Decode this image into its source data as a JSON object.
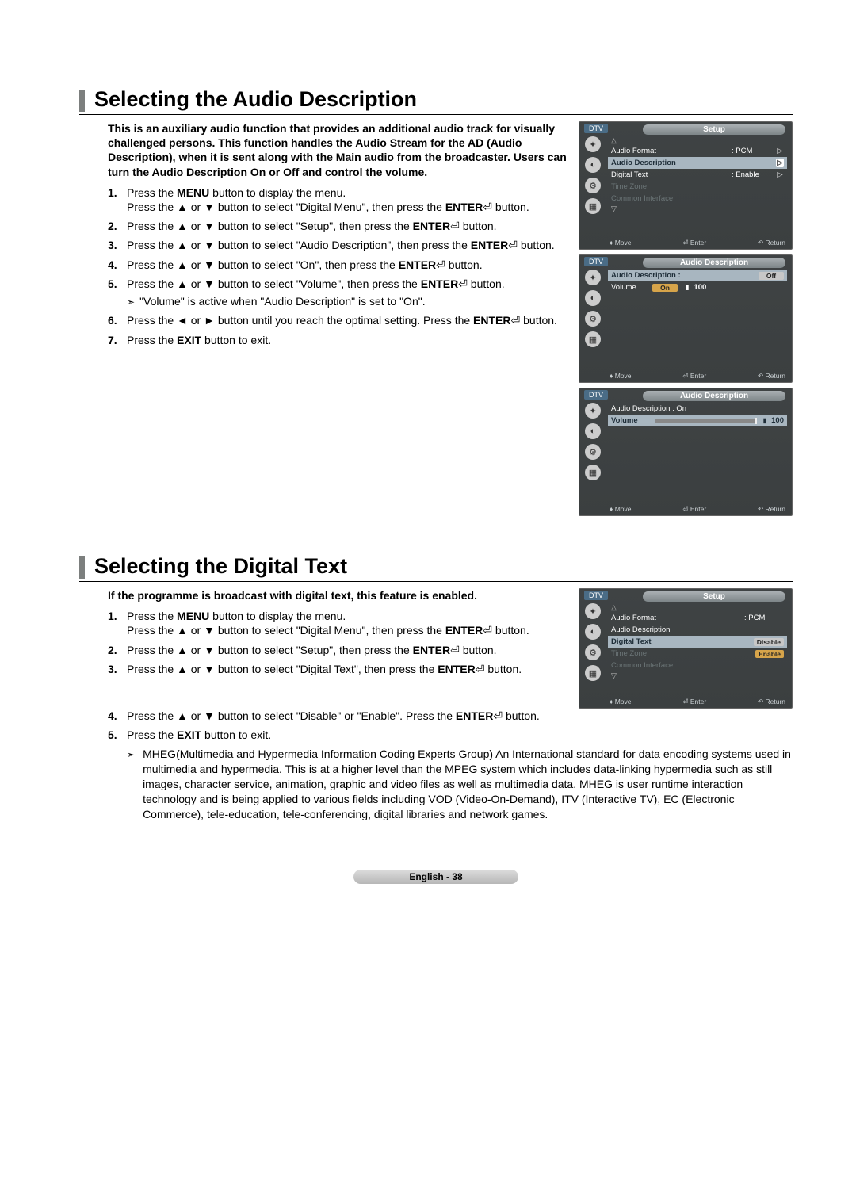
{
  "section1": {
    "heading": "Selecting the Audio Description",
    "intro": "This is an auxiliary audio function that provides an additional audio track for visually challenged persons. This function handles the Audio Stream for the AD (Audio Description), when it is sent along with the Main audio from the broadcaster. Users can turn the Audio Description On or Off and control the volume.",
    "steps": {
      "s1a": "Press the ",
      "s1b": "MENU",
      "s1c": " button to display the menu.\nPress the ▲ or ▼ button to select \"Digital Menu\", then press the ",
      "s1d": "ENTER",
      "s1e": " button.",
      "s2a": "Press the ▲ or ▼ button to select \"Setup\", then press the ",
      "s2b": "ENTER",
      "s2c": " button.",
      "s3a": "Press the ▲ or ▼ button to select \"Audio Description\", then press the ",
      "s3b": "ENTER",
      "s3c": " button.",
      "s4a": "Press the ▲ or ▼ button to select \"On\", then press the ",
      "s4b": "ENTER",
      "s4c": " button.",
      "s5a": "Press the ▲ or ▼ button to select \"Volume\", then press the ",
      "s5b": "ENTER",
      "s5c": " button.",
      "s5note": "\"Volume\" is active when \"Audio Description\" is set to \"On\".",
      "s6a": "Press the ◄ or ► button until you reach the optimal setting. Press the ",
      "s6b": "ENTER",
      "s6c": " button.",
      "s7a": "Press the ",
      "s7b": "EXIT",
      "s7c": " button to exit."
    }
  },
  "section2": {
    "heading": "Selecting the Digital Text",
    "intro": "If the programme is broadcast with digital text, this feature is enabled.",
    "steps": {
      "s1a": "Press the ",
      "s1b": "MENU",
      "s1c": " button to display the menu.\nPress the ▲ or ▼ button to select \"Digital Menu\", then press the ",
      "s1d": "ENTER",
      "s1e": " button.",
      "s2a": "Press the ▲ or ▼ button to select \"Setup\", then press the ",
      "s2b": "ENTER",
      "s2c": " button.",
      "s3a": "Press the ▲ or ▼ button to select \"Digital Text\", then press the ",
      "s3b": "ENTER",
      "s3c": " button.",
      "s4a": "Press the ▲ or ▼ button to select \"Disable\" or \"Enable\". Press the ",
      "s4b": "ENTER",
      "s4c": " button.",
      "s5a": "Press the ",
      "s5b": "EXIT",
      "s5c": " button to exit."
    },
    "mheg_note": "MHEG(Multimedia and Hypermedia Information Coding Experts Group) An International standard for data encoding systems used in multimedia and hypermedia. This is at a higher level than the MPEG system which includes data-linking hypermedia such as still images, character service, animation, graphic and video files as well as multimedia data. MHEG is user runtime interaction technology and is being applied to various fields including VOD (Video-On-Demand), ITV (Interactive TV), EC (Electronic Commerce), tele-education, tele-conferencing, digital libraries and network games."
  },
  "osd": {
    "dtv": "DTV",
    "setup": "Setup",
    "audio_desc_title": "Audio Description",
    "audio_format": "Audio Format",
    "pcm": ": PCM",
    "audio_desc": "Audio Description",
    "digital_text": "Digital Text",
    "enable": ": Enable",
    "time_zone": "Time Zone",
    "common_interface": "Common Interface",
    "audio_desc_colon": "Audio Description :",
    "volume": "Volume",
    "off": "Off",
    "on": "On",
    "on_colon": "Audio Description : On",
    "hundred": "100",
    "disable": "Disable",
    "enable_plain": "Enable",
    "move": "Move",
    "enter": "Enter",
    "return": "Return"
  },
  "footer": "English - 38"
}
